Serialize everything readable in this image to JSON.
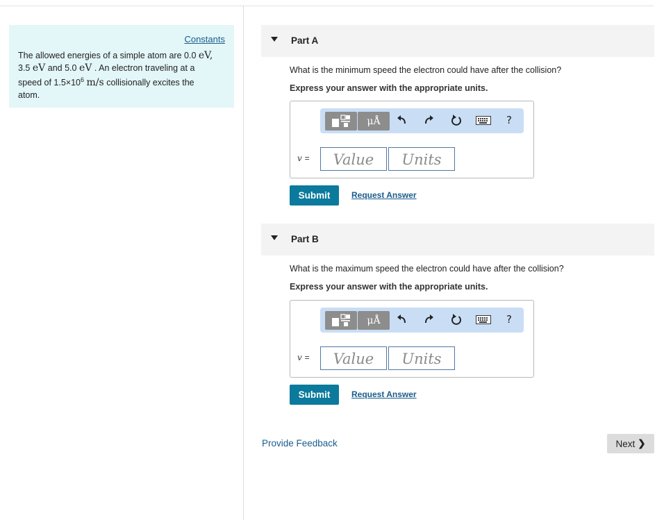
{
  "sidebar": {
    "constants_link": "Constants",
    "problem": {
      "t1": "The allowed energies of a simple atom are 0.0",
      "u1": "eV,",
      "n2": "3.5",
      "u2": "eV",
      "t2": "and 5.0",
      "u3": "eV",
      "t3": ". An electron traveling at a",
      "t4": "speed of 1.5×10",
      "exp": "6",
      "u4": "m/s",
      "t5": "collisionally excites the",
      "t6": "atom."
    }
  },
  "parts": [
    {
      "title": "Part A",
      "question": "What is the minimum speed the electron could have after the collision?",
      "instruction": "Express your answer with the appropriate units.",
      "variable": "v",
      "equals": "=",
      "value_placeholder": "Value",
      "units_placeholder": "Units",
      "submit_label": "Submit",
      "request_label": "Request Answer"
    },
    {
      "title": "Part B",
      "question": "What is the maximum speed the electron could have after the collision?",
      "instruction": "Express your answer with the appropriate units.",
      "variable": "v",
      "equals": "=",
      "value_placeholder": "Value",
      "units_placeholder": "Units",
      "submit_label": "Submit",
      "request_label": "Request Answer"
    }
  ],
  "toolbar": {
    "templates_icon": "fraction-template-icon",
    "units_label": "μÅ",
    "undo_icon": "undo-icon",
    "redo_icon": "redo-icon",
    "reset_icon": "reset-icon",
    "keyboard_icon": "keyboard-icon",
    "help_label": "?"
  },
  "footer": {
    "feedback_label": "Provide Feedback",
    "next_label": "Next",
    "next_chevron": "❯"
  },
  "colors": {
    "info_bg": "#e3f6f8",
    "toolbar_bg": "#c9def5",
    "submit_bg": "#0b7a9c",
    "link": "#1a5c8c"
  }
}
